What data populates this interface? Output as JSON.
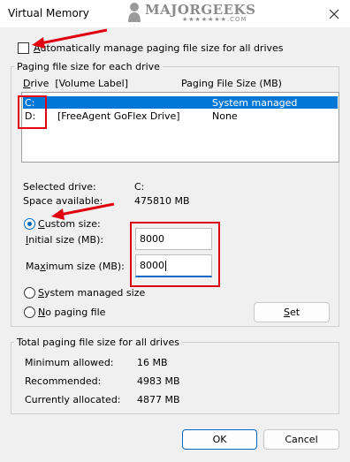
{
  "window": {
    "title": "Virtual Memory"
  },
  "watermark": {
    "text": "MAJORGEEKS",
    "sub": "★★★★★★★.COM"
  },
  "auto_manage": {
    "label_accel": "A",
    "label_rest": "utomatically manage paging file size for all drives",
    "checked": false
  },
  "paging_group": {
    "title": "Paging file size for each drive",
    "col_drive_accel": "D",
    "col_drive_rest": "rive",
    "col_volume": "[Volume Label]",
    "col_size": "Paging File Size (MB)",
    "drives": [
      {
        "drive": "C:",
        "label": "",
        "size": "System managed",
        "selected": true
      },
      {
        "drive": "D:",
        "label": "[FreeAgent GoFlex Drive]",
        "size": "None",
        "selected": false
      }
    ],
    "selected_drive_label": "Selected drive:",
    "selected_drive_value": "C:",
    "space_label": "Space available:",
    "space_value": "475810 MB",
    "custom_accel": "C",
    "custom_rest": "ustom size:",
    "initial_accel": "I",
    "initial_rest": "nitial size (MB):",
    "initial_value": "8000",
    "max_pre": "Ma",
    "max_accel": "x",
    "max_rest": "imum size (MB):",
    "max_value": "8000",
    "system_accel": "S",
    "system_rest": "ystem managed size",
    "nopaging_accel": "N",
    "nopaging_rest": "o paging file",
    "set_accel": "S",
    "set_rest": "et",
    "mode": "custom"
  },
  "total_group": {
    "title": "Total paging file size for all drives",
    "rows": [
      {
        "label": "Minimum allowed:",
        "value": "16 MB"
      },
      {
        "label": "Recommended:",
        "value": "4983 MB"
      },
      {
        "label": "Currently allocated:",
        "value": "4877 MB"
      }
    ]
  },
  "buttons": {
    "ok": "OK",
    "cancel": "Cancel"
  },
  "colors": {
    "accent": "#0067c0",
    "selection": "#0078d7",
    "annotation": "#e0000f"
  }
}
